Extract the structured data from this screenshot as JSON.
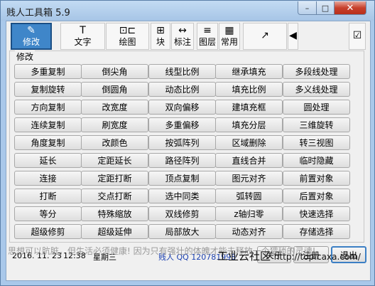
{
  "window": {
    "title": "贱人工具箱 5.9"
  },
  "caption": {
    "min": "–",
    "max": "□",
    "close": "✕"
  },
  "toolbar": [
    {
      "label": "修改",
      "icon": "✎",
      "icon_name": "pencil-icon",
      "active": true
    },
    {
      "label": "文字",
      "icon": "T",
      "icon_name": "text-icon"
    },
    {
      "label": "绘图",
      "icon": "⊡⊏",
      "icon_name": "drawing-icon"
    },
    {
      "label": "块",
      "icon": "⊞",
      "icon_name": "block-icon"
    },
    {
      "label": "标注",
      "icon": "↔",
      "icon_name": "dimension-icon"
    },
    {
      "label": "图层",
      "icon": "≡",
      "icon_name": "layers-icon"
    },
    {
      "label": "常用",
      "icon": "▦",
      "icon_name": "common-icon"
    },
    {
      "label": "",
      "icon": "↗",
      "icon_name": "external-link-icon"
    },
    {
      "label": "",
      "icon": "◀",
      "icon_name": "scroll-left-icon"
    },
    {
      "label": "",
      "icon": "☑",
      "icon_name": "pin-checkbox-icon"
    }
  ],
  "group": {
    "title": "修改",
    "buttons": [
      [
        "多重复制",
        "倒尖角",
        "线型比例",
        "继承填充",
        "多段线处理"
      ],
      [
        "复制旋转",
        "倒圆角",
        "动态比例",
        "填充比例",
        "多义线处理"
      ],
      [
        "方向复制",
        "改宽度",
        "双向偏移",
        "建填充框",
        "圆处理"
      ],
      [
        "连续复制",
        "刷宽度",
        "多重偏移",
        "填充分层",
        "三维旋转"
      ],
      [
        "角度复制",
        "改颜色",
        "按弧阵列",
        "区域删除",
        "转三视图"
      ],
      [
        "延长",
        "定距延长",
        "路径阵列",
        "直线合并",
        "临时隐藏"
      ],
      [
        "连接",
        "定距打断",
        "顶点复制",
        "图元对齐",
        "前置对象"
      ],
      [
        "打断",
        "交点打断",
        "选中同类",
        "弧转圆",
        "后置对象"
      ],
      [
        "等分",
        "特殊缩放",
        "双线修剪",
        "z轴归零",
        "快速选择"
      ],
      [
        "超级修剪",
        "超级延伸",
        "局部放大",
        "动态对齐",
        "存储选择"
      ]
    ]
  },
  "status": {
    "date": "2016. 11. 23",
    "time": "12:38",
    "weekday": "星期三",
    "author": "贱人 QQ 120781998",
    "about": "关于",
    "register": "注册",
    "exit": "退出"
  },
  "tip": "思想可以肮脏，但生活必须健康! 因为只有强壮的体魄才能去释放一个猥琐的灵魂!",
  "watermark": {
    "site": "工业云社区",
    "url": "http://top.caxa.com/"
  }
}
